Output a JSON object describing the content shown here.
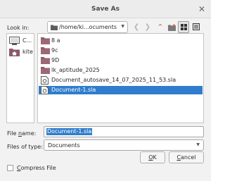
{
  "window": {
    "title": "Save As"
  },
  "toolbar": {
    "look_in_label": "Look in:",
    "path": "/home/ki...ocuments",
    "icons": [
      "back-arrow-icon",
      "forward-arrow-icon",
      "parent-folder-icon",
      "new-folder-icon",
      "list-view-icon",
      "detail-view-icon"
    ]
  },
  "sidebar": {
    "items": [
      {
        "label": "C...",
        "icon": "computer-icon"
      },
      {
        "label": "kite",
        "icon": "home-folder-icon"
      }
    ]
  },
  "files": [
    {
      "name": "8 a",
      "icon": "folder-icon"
    },
    {
      "name": "9c",
      "icon": "folder-icon"
    },
    {
      "name": "9D",
      "icon": "folder-icon"
    },
    {
      "name": "lk_aptitude_2025",
      "icon": "folder-icon"
    },
    {
      "name": "Document_autosave_14_07_2025_11_53.sla",
      "icon": "sla-file-icon"
    },
    {
      "name": "Document-1.sla",
      "icon": "sla-file-icon",
      "selected": true
    }
  ],
  "form": {
    "file_name_label": "File name:",
    "file_name_value": "Document-1.sla",
    "file_type_label": "Files of type:",
    "file_type_value": "Documents",
    "ok_label": "OK",
    "cancel_label": "Cancel",
    "compress_label": "Compress File",
    "compress_checked": false
  },
  "colors": {
    "selection": "#2f7dcc",
    "folder": "#8c5a66",
    "up_arrow": "#e0602a"
  }
}
